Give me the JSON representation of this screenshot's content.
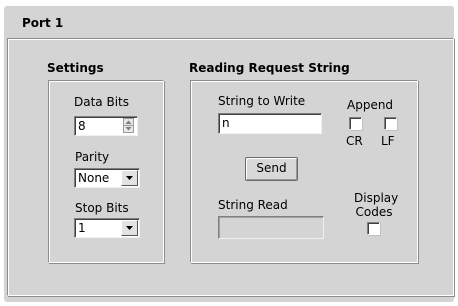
{
  "port": {
    "title": "Port 1"
  },
  "settings": {
    "title": "Settings",
    "data_bits": {
      "label": "Data Bits",
      "value": "8"
    },
    "parity": {
      "label": "Parity",
      "value": "None"
    },
    "stop_bits": {
      "label": "Stop Bits",
      "value": "1"
    }
  },
  "request": {
    "title": "Reading Request String",
    "string_to_write": {
      "label": "String to Write",
      "value": "n"
    },
    "append": {
      "label": "Append",
      "cr_label": "CR",
      "lf_label": "LF"
    },
    "send_button": "Send",
    "string_read": {
      "label": "String Read",
      "value": ""
    },
    "display_codes": {
      "label_line1": "Display",
      "label_line2": "Codes"
    }
  }
}
